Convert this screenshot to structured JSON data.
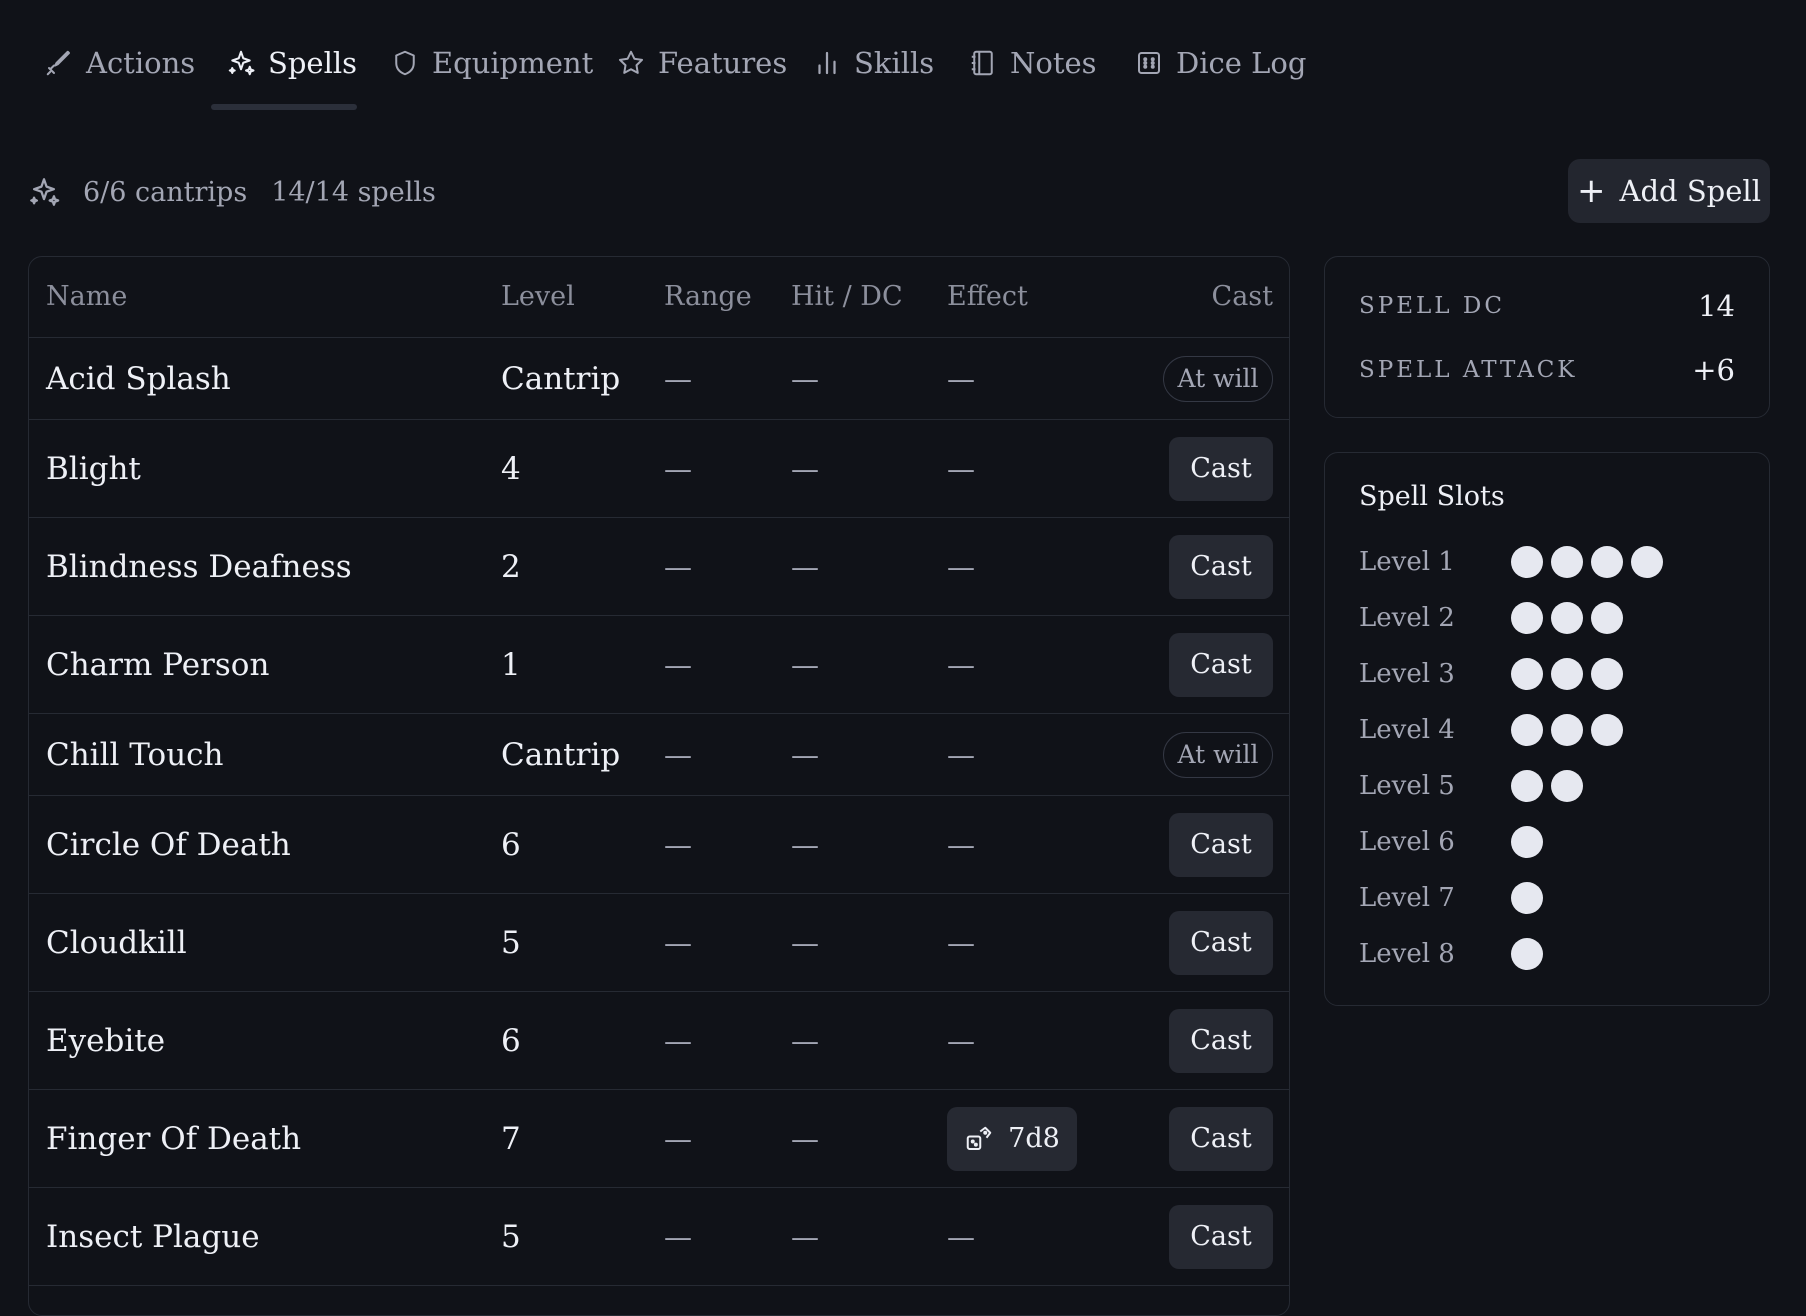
{
  "tabs": [
    {
      "label": "Actions",
      "icon": "sword-icon"
    },
    {
      "label": "Spells",
      "icon": "sparkles-icon"
    },
    {
      "label": "Equipment",
      "icon": "shield-icon"
    },
    {
      "label": "Features",
      "icon": "star-icon"
    },
    {
      "label": "Skills",
      "icon": "bar-chart-icon"
    },
    {
      "label": "Notes",
      "icon": "notebook-icon"
    },
    {
      "label": "Dice Log",
      "icon": "dice-icon"
    }
  ],
  "active_tab": "Spells",
  "summary": {
    "cantrips": "6/6 cantrips",
    "spells": "14/14 spells"
  },
  "add_spell_label": "Add Spell",
  "table": {
    "headers": {
      "name": "Name",
      "level": "Level",
      "range": "Range",
      "hit": "Hit / DC",
      "effect": "Effect",
      "cast": "Cast"
    },
    "dash": "—",
    "rows": [
      {
        "name": "Acid Splash",
        "level": "Cantrip",
        "range": "—",
        "hit": "—",
        "effect": "—",
        "action": "At will"
      },
      {
        "name": "Blight",
        "level": "4",
        "range": "—",
        "hit": "—",
        "effect": "—",
        "action": "Cast"
      },
      {
        "name": "Blindness Deafness",
        "level": "2",
        "range": "—",
        "hit": "—",
        "effect": "—",
        "action": "Cast"
      },
      {
        "name": "Charm Person",
        "level": "1",
        "range": "—",
        "hit": "—",
        "effect": "—",
        "action": "Cast"
      },
      {
        "name": "Chill Touch",
        "level": "Cantrip",
        "range": "—",
        "hit": "—",
        "effect": "—",
        "action": "At will"
      },
      {
        "name": "Circle Of Death",
        "level": "6",
        "range": "—",
        "hit": "—",
        "effect": "—",
        "action": "Cast"
      },
      {
        "name": "Cloudkill",
        "level": "5",
        "range": "—",
        "hit": "—",
        "effect": "—",
        "action": "Cast"
      },
      {
        "name": "Eyebite",
        "level": "6",
        "range": "—",
        "hit": "—",
        "effect": "—",
        "action": "Cast"
      },
      {
        "name": "Finger Of Death",
        "level": "7",
        "range": "—",
        "hit": "—",
        "effect": "7d8",
        "action": "Cast"
      },
      {
        "name": "Insect Plague",
        "level": "5",
        "range": "—",
        "hit": "—",
        "effect": "—",
        "action": "Cast"
      }
    ]
  },
  "stats": {
    "spell_dc_label": "SPELL DC",
    "spell_dc": "14",
    "spell_attack_label": "SPELL ATTACK",
    "spell_attack": "+6"
  },
  "slots": {
    "title": "Spell Slots",
    "levels": [
      {
        "label": "Level 1",
        "count": 4
      },
      {
        "label": "Level 2",
        "count": 3
      },
      {
        "label": "Level 3",
        "count": 3
      },
      {
        "label": "Level 4",
        "count": 3
      },
      {
        "label": "Level 5",
        "count": 2
      },
      {
        "label": "Level 6",
        "count": 1
      },
      {
        "label": "Level 7",
        "count": 1
      },
      {
        "label": "Level 8",
        "count": 1
      }
    ]
  }
}
